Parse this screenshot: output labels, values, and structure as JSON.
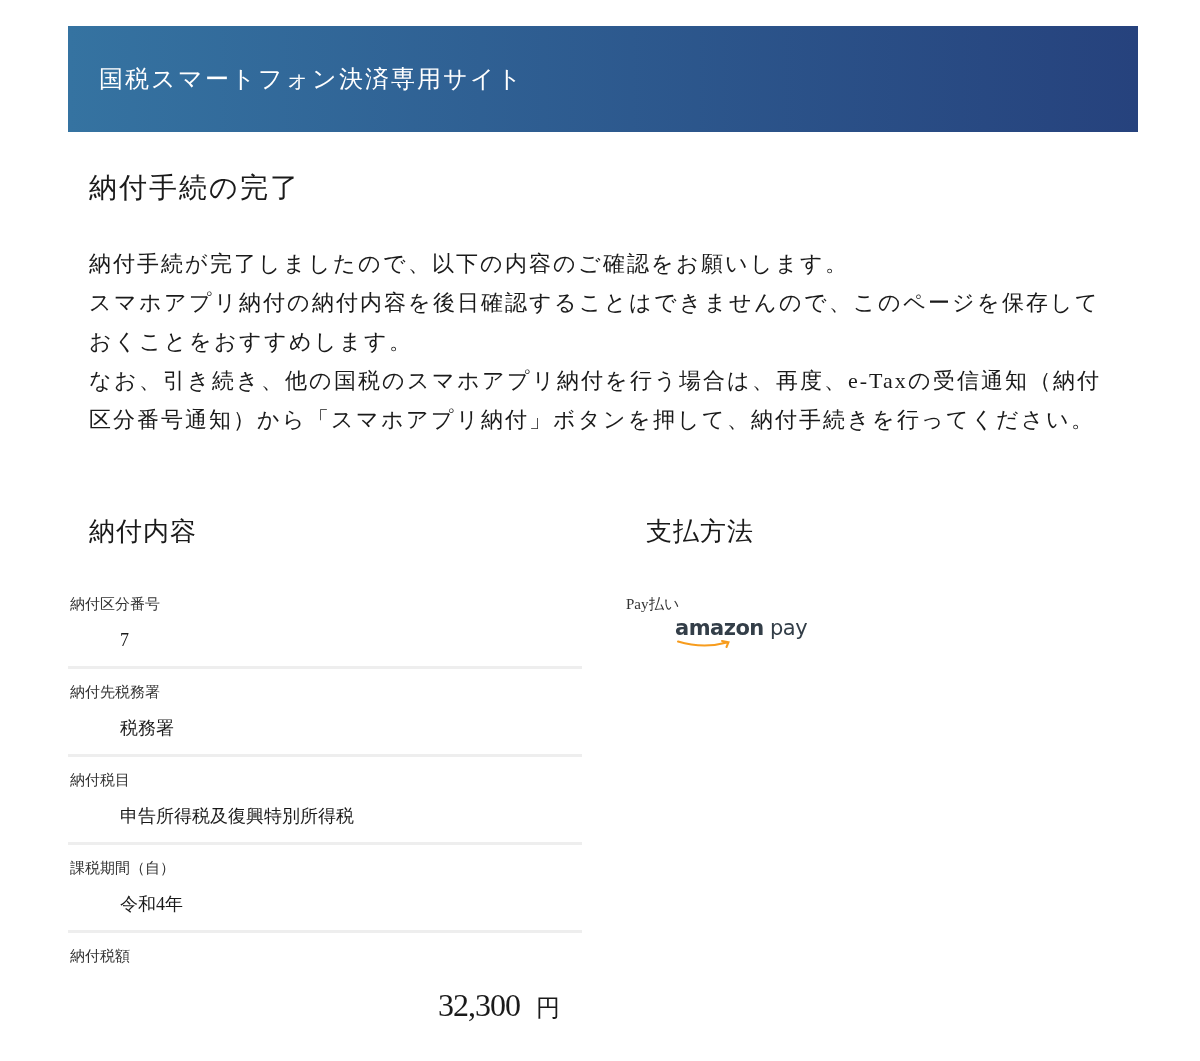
{
  "header": {
    "title": "国税スマートフォン決済専用サイト"
  },
  "page_title": "納付手続の完了",
  "message": [
    "納付手続が完了しましたので、以下の内容のご確認をお願いします。",
    "スマホアプリ納付の納付内容を後日確認することはできませんので、このページを保存しておくことをおすすめします。",
    "なお、引き続き、他の国税のスマホアプリ納付を行う場合は、再度、e-Taxの受信通知（納付区分番号通知）から「スマホアプリ納付」ボタンを押して、納付手続きを行ってください。"
  ],
  "payment_details": {
    "heading": "納付内容",
    "fields": [
      {
        "kind": "text",
        "label": "納付区分番号",
        "value": "7"
      },
      {
        "kind": "text",
        "label": "納付先税務署",
        "value": "税務署"
      },
      {
        "kind": "text",
        "label": "納付税目",
        "value": "申告所得税及復興特別所得税"
      },
      {
        "kind": "text",
        "label": "課税期間（自）",
        "value": "令和4年"
      },
      {
        "kind": "amount",
        "label": "納付税額",
        "value": "32,300",
        "unit": "円"
      }
    ]
  },
  "payment_method": {
    "heading": "支払方法",
    "label": "Pay払い",
    "logo": "**amazon** pay"
  }
}
